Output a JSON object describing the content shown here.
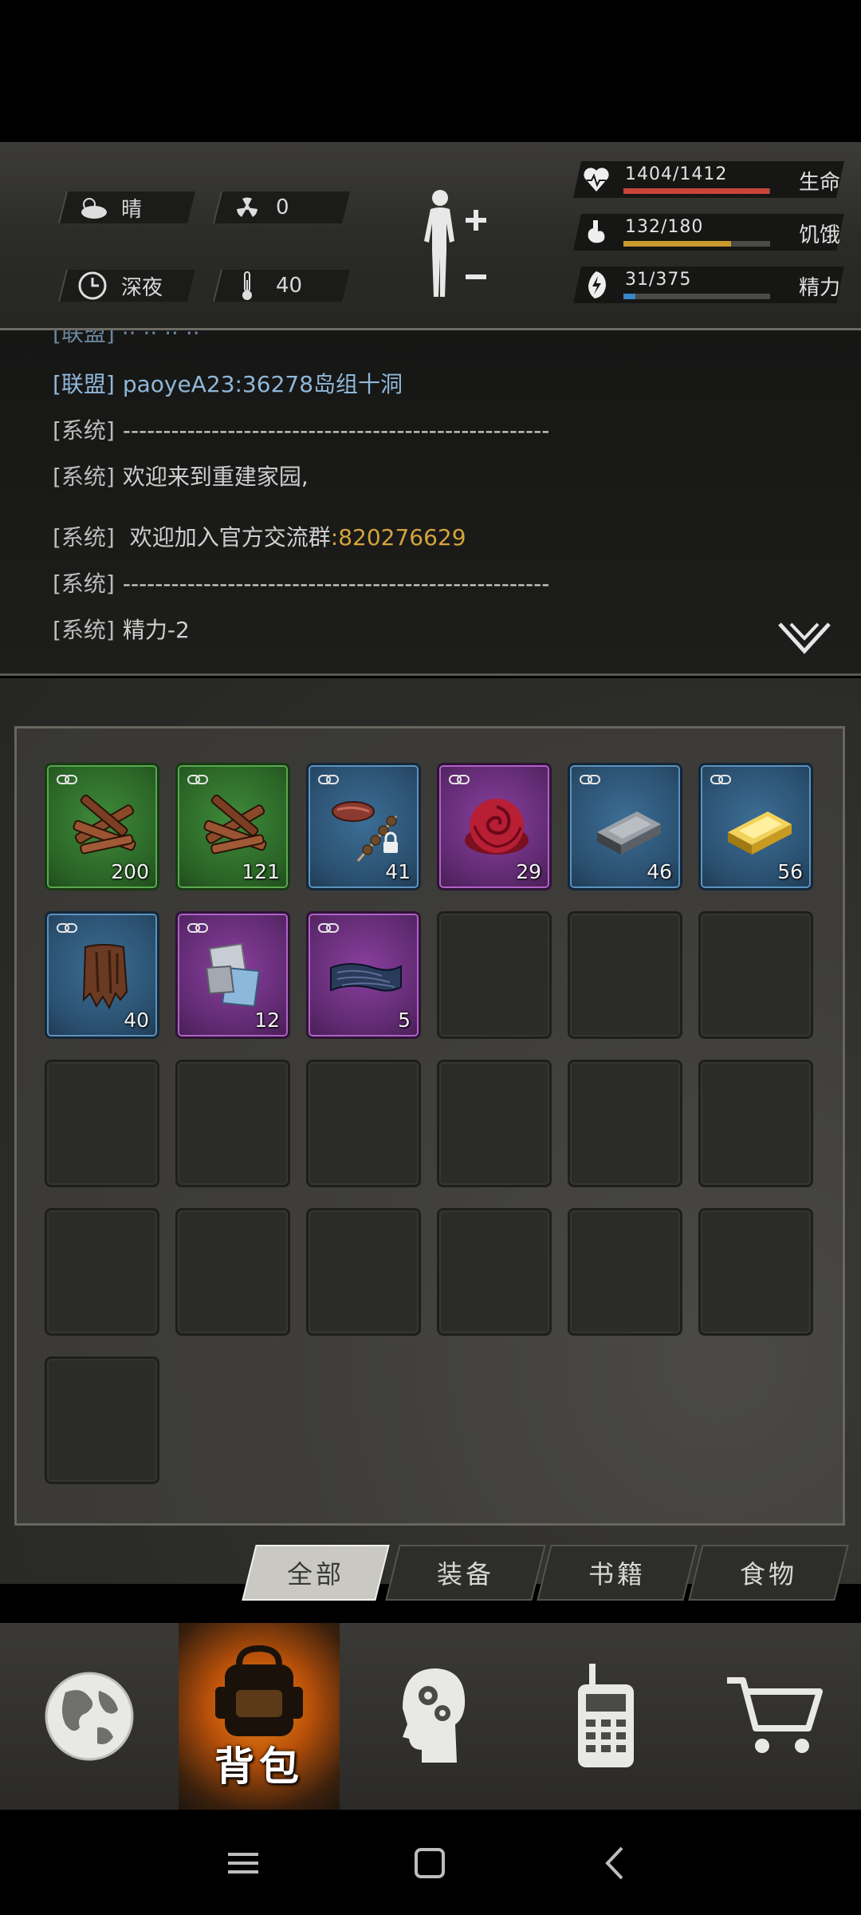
{
  "status": {
    "weather": "晴",
    "radiation": "0",
    "time_of_day": "深夜",
    "temperature": "40",
    "stats": [
      {
        "label": "生命",
        "value": "1404/1412",
        "fraction": 0.994,
        "color": "#c8443a",
        "icon": "heart-icon"
      },
      {
        "label": "饥饿",
        "value": "132/180",
        "fraction": 0.733,
        "color": "#c99a2e",
        "icon": "stomach-icon"
      },
      {
        "label": "精力",
        "value": "31/375",
        "fraction": 0.083,
        "color": "#3a86c8",
        "icon": "energy-icon"
      }
    ]
  },
  "chat": {
    "lines": [
      {
        "tag": "[联盟]",
        "text": "paoyeA23:36278岛组十洞",
        "type": "alliance"
      },
      {
        "tag": "[系统]",
        "text": "-----------------------------------------------------",
        "type": "system"
      },
      {
        "tag": "[系统]",
        "text": "欢迎来到重建家园,",
        "type": "system"
      },
      {
        "tag": "[系统]",
        "text": " 欢迎加入官方交流群",
        "link": ":820276629",
        "type": "system"
      },
      {
        "tag": "[系统]",
        "text": "-----------------------------------------------------",
        "type": "system"
      },
      {
        "tag": "[系统]",
        "text": "精力-2",
        "type": "system"
      }
    ]
  },
  "inventory": {
    "items": [
      {
        "name": "firewood",
        "count": "200",
        "rarity": "green"
      },
      {
        "name": "firewood",
        "count": "121",
        "rarity": "green"
      },
      {
        "name": "meat-skewer",
        "count": "41",
        "rarity": "blue",
        "locked": true
      },
      {
        "name": "rose",
        "count": "29",
        "rarity": "purple"
      },
      {
        "name": "iron-ingot",
        "count": "46",
        "rarity": "blue"
      },
      {
        "name": "gold-bar",
        "count": "56",
        "rarity": "blue"
      },
      {
        "name": "bark",
        "count": "40",
        "rarity": "blue"
      },
      {
        "name": "cloth",
        "count": "12",
        "rarity": "purple"
      },
      {
        "name": "leather",
        "count": "5",
        "rarity": "purple"
      }
    ],
    "total_slots": 25
  },
  "tabs": [
    {
      "label": "全部",
      "active": true
    },
    {
      "label": "装备",
      "active": false
    },
    {
      "label": "书籍",
      "active": false
    },
    {
      "label": "食物",
      "active": false
    }
  ],
  "nav": {
    "items": [
      {
        "icon": "globe-icon"
      },
      {
        "icon": "backpack-icon",
        "label": "背包",
        "active": true
      },
      {
        "icon": "brain-head-icon"
      },
      {
        "icon": "radio-icon"
      },
      {
        "icon": "cart-icon"
      }
    ]
  }
}
